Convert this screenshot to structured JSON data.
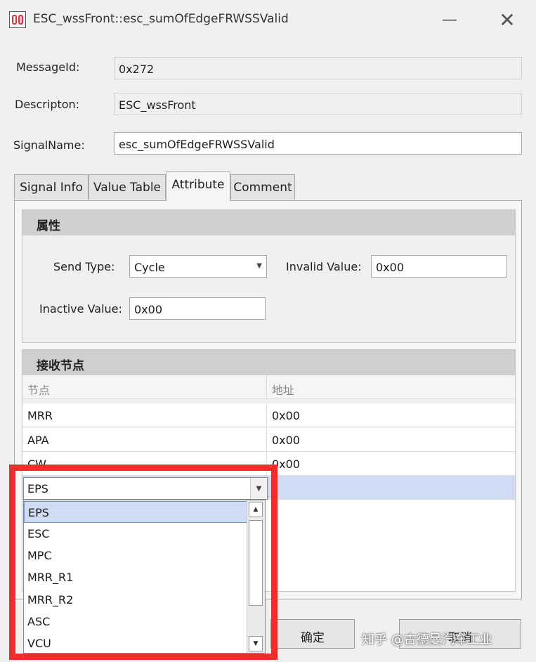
{
  "window": {
    "title": "ESC_wssFront::esc_sumOfEdgeFRWSSValid",
    "minimize_glyph": "—",
    "close_glyph": "✕"
  },
  "fields": {
    "message_id_label": "MessageId:",
    "message_id_value": "0x272",
    "description_label": "Descripton:",
    "description_value": "ESC_wssFront",
    "signal_name_label": "SignalName:",
    "signal_name_value": "esc_sumOfEdgeFRWSSValid"
  },
  "tabs": [
    {
      "label": "Signal Info"
    },
    {
      "label": "Value Table"
    },
    {
      "label": "Attribute",
      "active": true
    },
    {
      "label": "Comment"
    }
  ],
  "attributes": {
    "heading": "属性",
    "send_type_label": "Send Type:",
    "send_type_value": "Cycle",
    "invalid_value_label": "Invalid Value:",
    "invalid_value_value": "0x00",
    "inactive_value_label": "Inactive Value:",
    "inactive_value_value": "0x00"
  },
  "receive_nodes": {
    "heading": "接收节点",
    "columns": [
      "节点",
      "地址"
    ],
    "rows": [
      {
        "node": "MRR",
        "address": "0x00"
      },
      {
        "node": "APA",
        "address": "0x00"
      },
      {
        "node": "CW",
        "address": "0x00"
      }
    ],
    "editing_value": "EPS",
    "dropdown_options": [
      "EPS",
      "ESC",
      "MPC",
      "MRR_R1",
      "MRR_R2",
      "ASC",
      "VCU"
    ],
    "highlighted_option": "EPS"
  },
  "buttons": {
    "ok_label": "确定",
    "cancel_label": "取消"
  },
  "watermark": "知乎 @古德曼汽车工业",
  "icons": {
    "dropdown_arrow": "▼",
    "scroll_up": "▲",
    "scroll_down": "▼"
  },
  "colors": {
    "highlight_border": "#ee2d2d",
    "selection": "#cfdcf3",
    "group_header": "#cfcfcf"
  }
}
